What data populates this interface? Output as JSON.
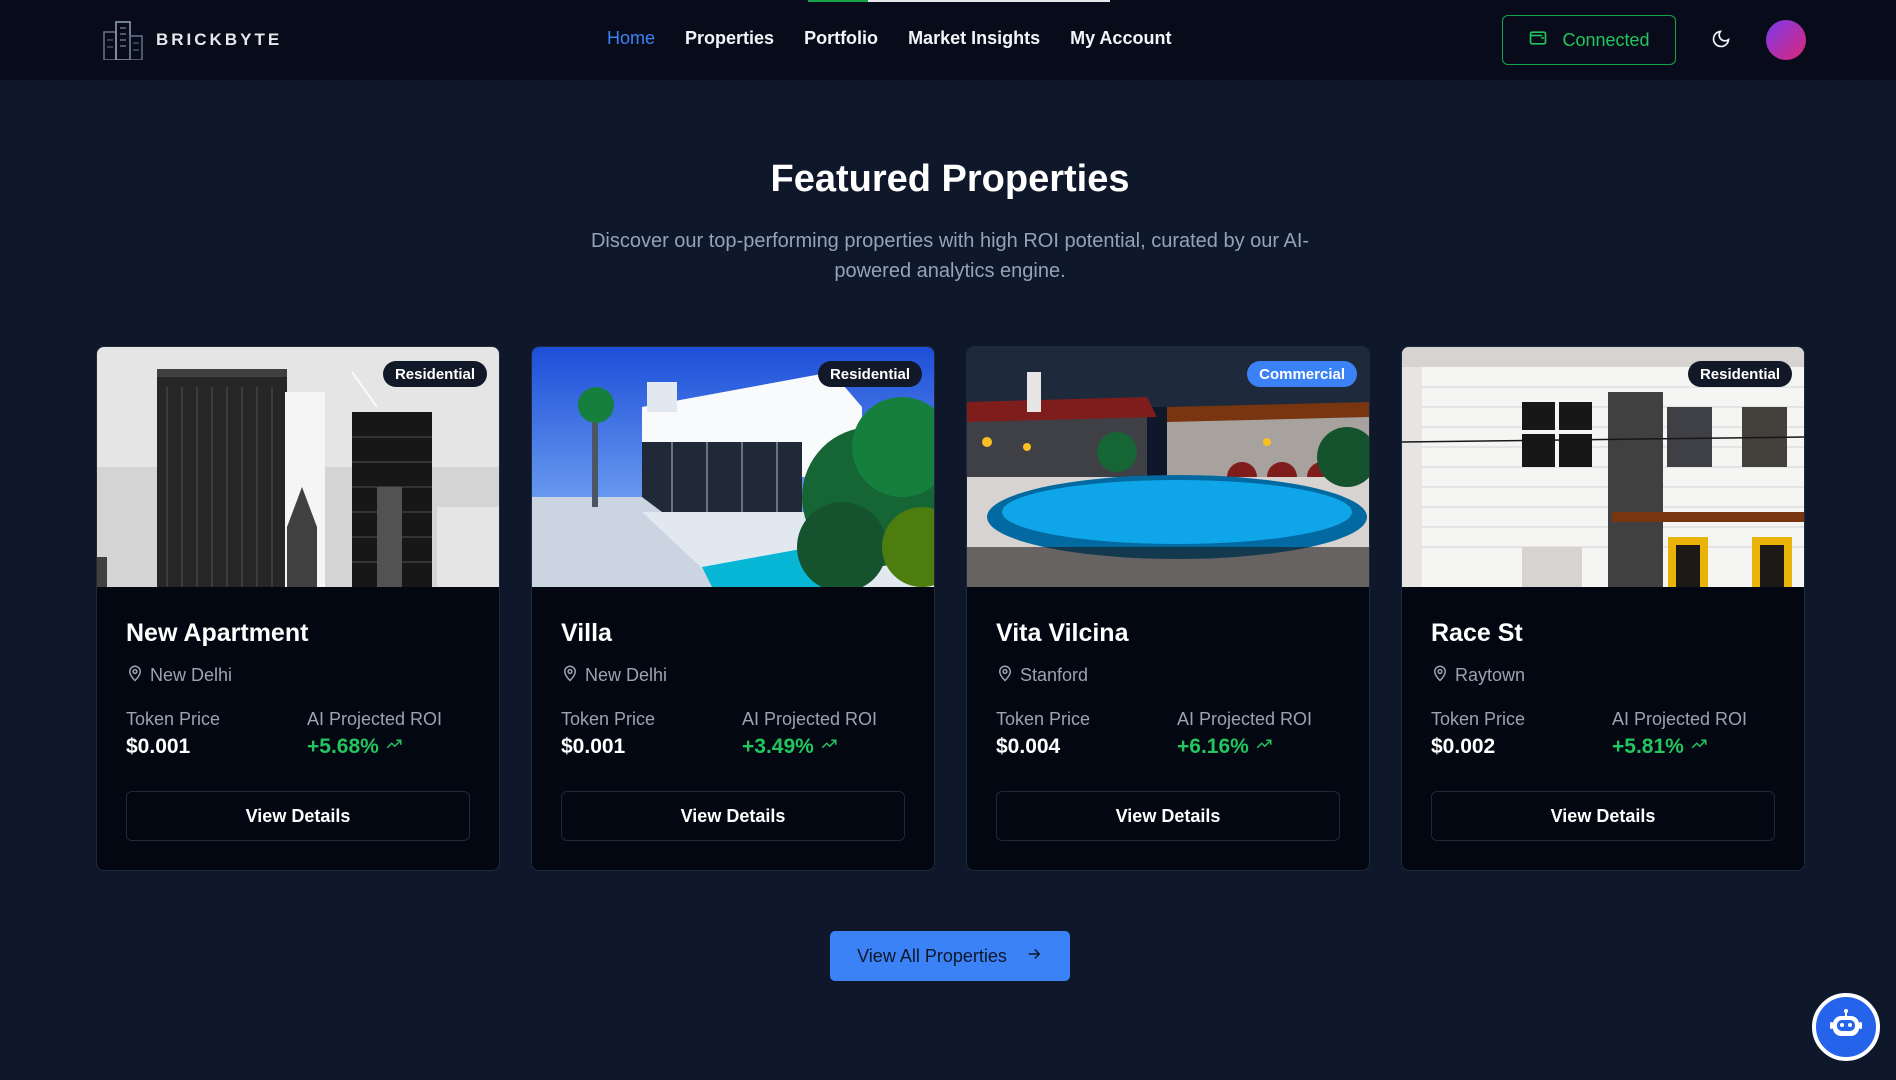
{
  "brand": {
    "name": "BRICKBYTE"
  },
  "nav": {
    "links": [
      {
        "label": "Home",
        "active": true
      },
      {
        "label": "Properties"
      },
      {
        "label": "Portfolio"
      },
      {
        "label": "Market Insights"
      },
      {
        "label": "My Account"
      }
    ],
    "connect_label": "Connected",
    "progress_fraction": 0.2
  },
  "hero": {
    "title": "Featured Properties",
    "subtitle": "Discover our top-performing properties with high ROI potential, curated by our AI-powered analytics engine."
  },
  "labels": {
    "token_price": "Token Price",
    "roi": "AI Projected ROI",
    "view_details": "View Details"
  },
  "properties": [
    {
      "title": "New Apartment",
      "location": "New Delhi",
      "category": "Residential",
      "token_price": "$0.001",
      "roi": "+5.68%",
      "image": "bw-skyline"
    },
    {
      "title": "Villa",
      "location": "New Delhi",
      "category": "Residential",
      "token_price": "$0.001",
      "roi": "+3.49%",
      "image": "white-villa-pool"
    },
    {
      "title": "Vita Vilcina",
      "location": "Stanford",
      "category": "Commercial",
      "token_price": "$0.004",
      "roi": "+6.16%",
      "image": "night-pool-villa"
    },
    {
      "title": "Race St",
      "location": "Raytown",
      "category": "Residential",
      "token_price": "$0.002",
      "roi": "+5.81%",
      "image": "white-townhouse"
    }
  ],
  "cta": {
    "view_all": "View All Properties"
  },
  "colors": {
    "accent": "#3b82f6",
    "success": "#22c55e",
    "background": "#0f172a",
    "card": "#030712"
  },
  "icons": {
    "wallet": "wallet-icon",
    "theme": "moon-icon",
    "location": "map-pin-icon",
    "trend": "trending-up-icon",
    "arrow": "arrow-right-icon",
    "assistant": "robot-icon"
  }
}
